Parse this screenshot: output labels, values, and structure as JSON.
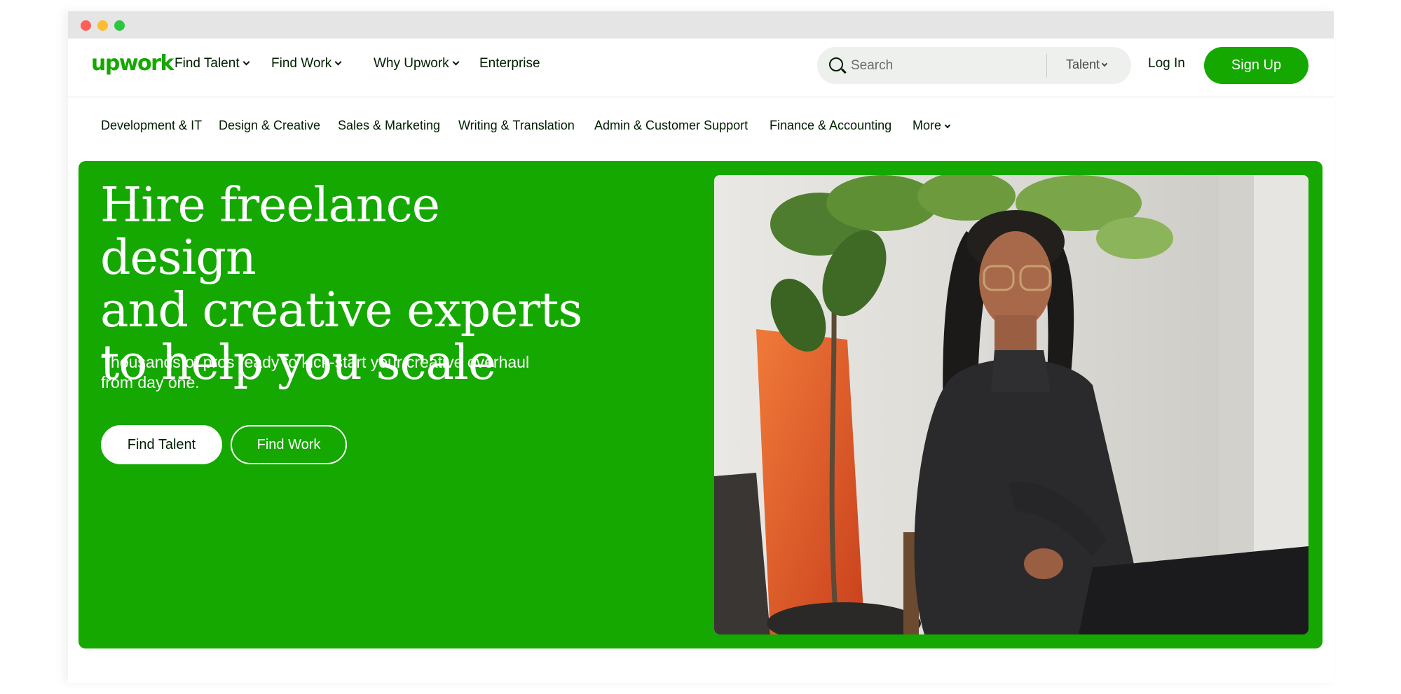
{
  "brand": {
    "logo_text": "upwork",
    "color": "#14a800"
  },
  "top_nav": {
    "links": [
      {
        "label": "Find Talent",
        "dropdown": true
      },
      {
        "label": "Find Work",
        "dropdown": true
      },
      {
        "label": "Why Upwork",
        "dropdown": true
      },
      {
        "label": "Enterprise",
        "dropdown": false
      }
    ],
    "search": {
      "placeholder": "Search",
      "icon": "search-icon",
      "scope": "Talent"
    },
    "login_label": "Log In",
    "signup_label": "Sign Up"
  },
  "category_nav": {
    "items": [
      "Development & IT",
      "Design & Creative",
      "Sales & Marketing",
      "Writing & Translation",
      "Admin & Customer Support",
      "Finance & Accounting"
    ],
    "more_label": "More"
  },
  "hero": {
    "title_lines": [
      "Hire freelance design",
      "and creative experts",
      "to help you scale"
    ],
    "subtitle_lines": [
      "Thousands of pros ready to kick-start your creative overhaul",
      "from day one."
    ],
    "primary_button": "Find Talent",
    "secondary_button": "Find Work",
    "background_color": "#14a800"
  }
}
